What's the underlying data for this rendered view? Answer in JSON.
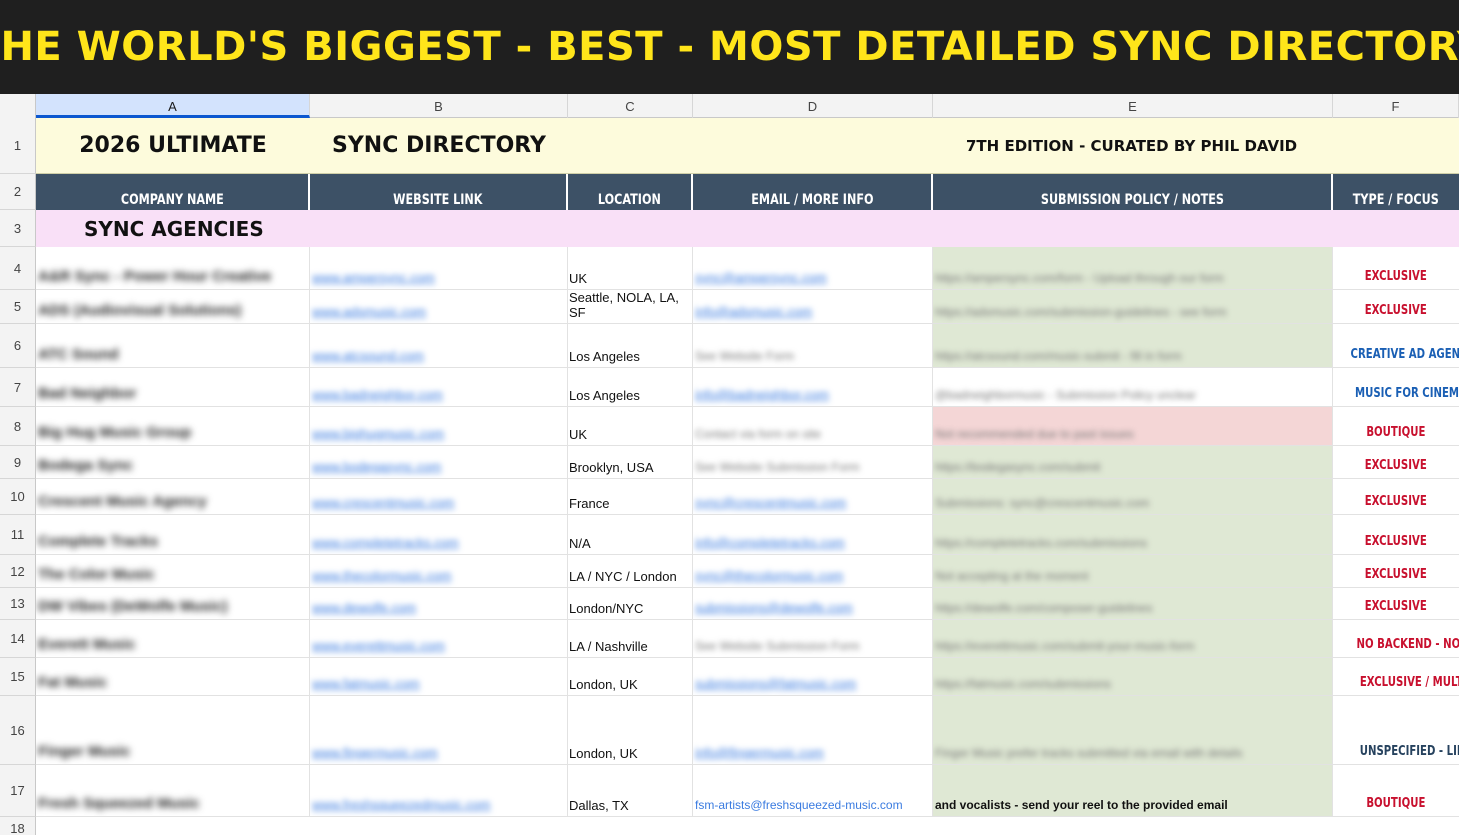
{
  "banner": {
    "title": "THE WORLD'S BIGGEST - BEST - MOST DETAILED SYNC DIRECTORY"
  },
  "columns": [
    "A",
    "B",
    "C",
    "D",
    "E",
    "F"
  ],
  "row_numbers": [
    "1",
    "2",
    "3",
    "4",
    "5",
    "6",
    "7",
    "8",
    "9",
    "10",
    "11",
    "12",
    "13",
    "14",
    "15",
    "16",
    "17",
    "18"
  ],
  "title_row": {
    "left": "2026 ULTIMATE",
    "middle": "SYNC DIRECTORY",
    "edition": "7TH EDITION - CURATED BY PHIL DAVID"
  },
  "headers": [
    "COMPANY NAME",
    "WEBSITE LINK",
    "LOCATION",
    "EMAIL / MORE INFO",
    "SUBMISSION POLICY / NOTES",
    "TYPE / FOCUS"
  ],
  "section": "SYNC AGENCIES",
  "rows": [
    {
      "company": "A&R Sync - Power Hour Creative",
      "website": "www.ampersync.com",
      "location": "UK",
      "email": "sync@ampersync.com",
      "notes": "https://ampersync.com/form - Upload through our form",
      "type": "EXCLUSIVE"
    },
    {
      "company": "ADS (Audiovisual Solutions)",
      "website": "www.adsmusic.com",
      "location": "Seattle, NOLA, LA, SF",
      "email": "info@adsmusic.com",
      "notes": "https://adsmusic.com/submission-guidelines - see form",
      "type": "EXCLUSIVE"
    },
    {
      "company": "ATC Sound",
      "website": "www.atcsound.com",
      "location": "Los Angeles",
      "email": "See Website Form",
      "notes": "https://atcsound.com/music-submit - fill in form",
      "type": "CREATIVE AD AGENCY"
    },
    {
      "company": "Bad Neighbor",
      "website": "www.badneighbor.com",
      "location": "Los Angeles",
      "email": "info@badneighbor.com",
      "notes": "@badneighbormusic - Submission Policy unclear",
      "type": "MUSIC FOR CINEMATIC ADS"
    },
    {
      "company": "Big Hug Music Group",
      "website": "www.bighugmusic.com",
      "location": "UK",
      "email": "Contact via form on site",
      "notes": "Not recommended due to past issues",
      "type": "BOUTIQUE"
    },
    {
      "company": "Bodega Sync",
      "website": "www.bodegasync.com",
      "location": "Brooklyn, USA",
      "email": "See Website Submission Form",
      "notes": "https://bodegasync.com/submit",
      "type": "EXCLUSIVE"
    },
    {
      "company": "Crescent Music Agency",
      "website": "www.crescentmusic.com",
      "location": "France",
      "email": "sync@crescentmusic.com",
      "notes": "Submissions: sync@crescentmusic.com",
      "type": "EXCLUSIVE"
    },
    {
      "company": "Complete Tracks",
      "website": "www.completetracks.com",
      "location": "N/A",
      "email": "info@completetracks.com",
      "notes": "https://completetracks.com/submissions",
      "type": "EXCLUSIVE"
    },
    {
      "company": "The Color Music",
      "website": "www.thecolormusic.com",
      "location": "LA / NYC / London",
      "email": "sync@thecolormusic.com",
      "notes": "Not accepting at the moment",
      "type": "EXCLUSIVE"
    },
    {
      "company": "DW Vibes (DeWolfe Music)",
      "website": "www.dewolfe.com",
      "location": "London/NYC",
      "email": "submissions@dewolfe.com",
      "notes": "https://dewolfe.com/composer-guidelines",
      "type": "EXCLUSIVE"
    },
    {
      "company": "Everett Music",
      "website": "www.everettmusic.com",
      "location": "LA / Nashville",
      "email": "See Website Submission Form",
      "notes": "https://everettmusic.com/submit-your-music-form",
      "type": "NO BACKEND - NO RETITLING"
    },
    {
      "company": "Fat Music",
      "website": "www.fatmusic.com",
      "location": "London, UK",
      "email": "submissions@fatmusic.com",
      "notes": "https://fatmusic.com/submissions",
      "type": "EXCLUSIVE / MULTIPLE LIBRARIES"
    },
    {
      "company": "Finger Music",
      "website": "www.fingermusic.com",
      "location": "London, UK",
      "email": "info@fingermusic.com",
      "notes": "Finger Music prefer tracks submitted via email with details",
      "type": "UNSPECIFIED - LIKELY EXCLUSIVE"
    },
    {
      "company": "Fresh Squeezed Music",
      "website": "www.freshsqueezedmusic.com",
      "location": "Dallas, TX",
      "email": "fsm-artists@freshsqueezed-music.com",
      "notes": "and vocalists  - send your reel to the provided email",
      "type": "BOUTIQUE"
    }
  ]
}
